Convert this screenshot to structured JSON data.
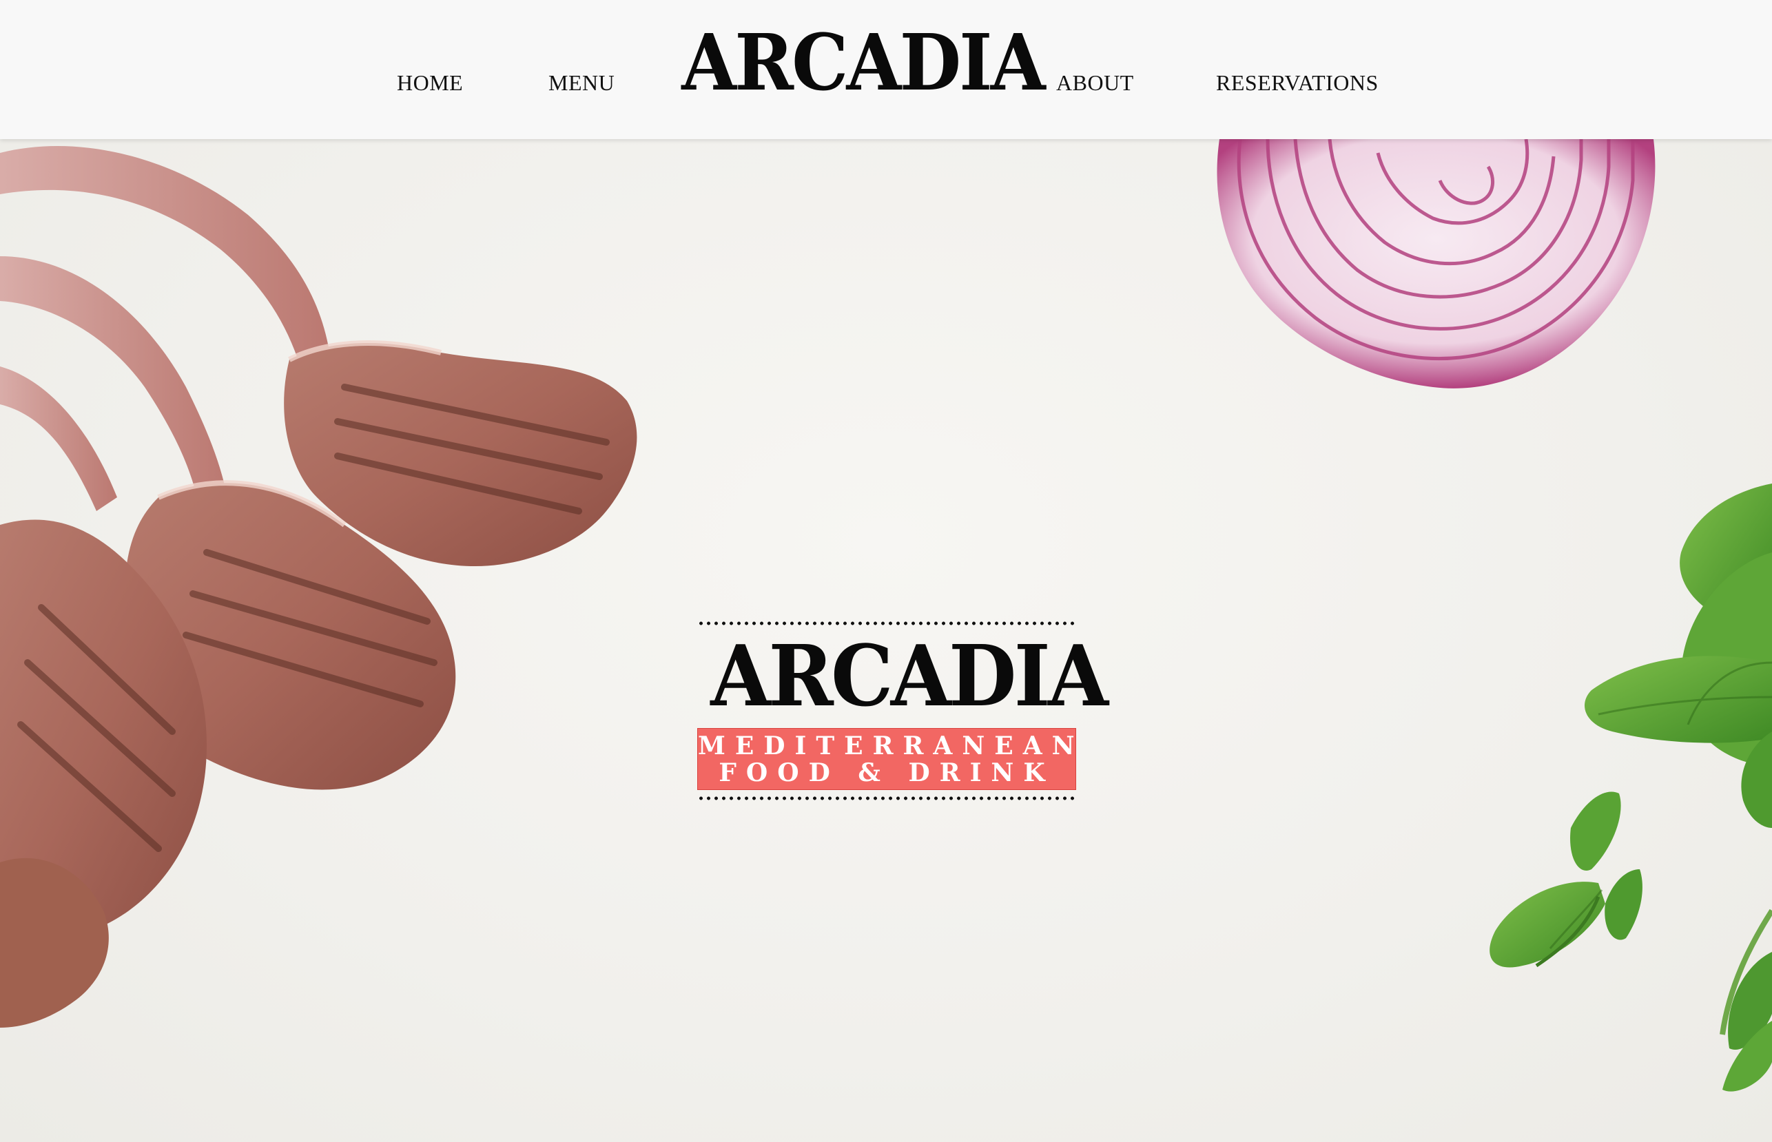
{
  "header": {
    "logo_text": "ARCADIA",
    "nav": {
      "home": "HOME",
      "menu": "MENU",
      "about": "ABOUT",
      "reservations": "RESERVATIONS"
    }
  },
  "hero": {
    "emblem": {
      "title": "ARCADIA",
      "tagline_line1": "MEDITERRANEAN",
      "tagline_line2": "FOOD & DRINK"
    },
    "images": [
      "grilled-lamb-chops",
      "red-onion-slice",
      "basil-leaves"
    ]
  },
  "colors": {
    "header_bg": "#f8f8f8",
    "hero_bg": "#f1f0ec",
    "logo_text": "#0a0a0a",
    "tagline_band": "#f26763",
    "tagline_text": "#ffffff"
  }
}
